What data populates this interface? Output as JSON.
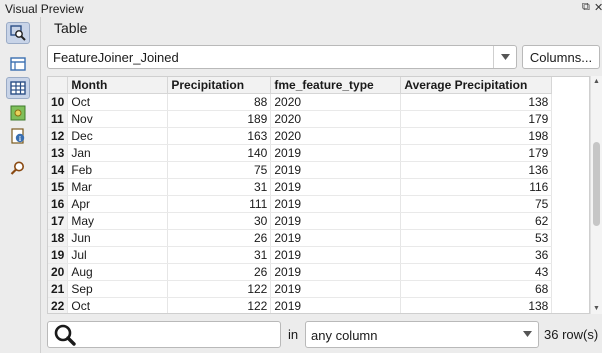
{
  "window": {
    "title": "Visual Preview"
  },
  "panel": {
    "label": "Table"
  },
  "dataset": {
    "selected": "FeatureJoiner_Joined",
    "columns_button": "Columns..."
  },
  "table": {
    "headers": [
      "Month",
      "Precipitation",
      "fme_feature_type",
      "Average Precipitation"
    ],
    "rows": [
      {
        "n": "10",
        "month": "Oct",
        "precip": "88",
        "type": "2020",
        "avg": "138"
      },
      {
        "n": "11",
        "month": "Nov",
        "precip": "189",
        "type": "2020",
        "avg": "179"
      },
      {
        "n": "12",
        "month": "Dec",
        "precip": "163",
        "type": "2020",
        "avg": "198"
      },
      {
        "n": "13",
        "month": "Jan",
        "precip": "140",
        "type": "2019",
        "avg": "179"
      },
      {
        "n": "14",
        "month": "Feb",
        "precip": "75",
        "type": "2019",
        "avg": "136"
      },
      {
        "n": "15",
        "month": "Mar",
        "precip": "31",
        "type": "2019",
        "avg": "116"
      },
      {
        "n": "16",
        "month": "Apr",
        "precip": "111",
        "type": "2019",
        "avg": "75"
      },
      {
        "n": "17",
        "month": "May",
        "precip": "30",
        "type": "2019",
        "avg": "62"
      },
      {
        "n": "18",
        "month": "Jun",
        "precip": "26",
        "type": "2019",
        "avg": "53"
      },
      {
        "n": "19",
        "month": "Jul",
        "precip": "31",
        "type": "2019",
        "avg": "36"
      },
      {
        "n": "20",
        "month": "Aug",
        "precip": "26",
        "type": "2019",
        "avg": "43"
      },
      {
        "n": "21",
        "month": "Sep",
        "precip": "122",
        "type": "2019",
        "avg": "68"
      },
      {
        "n": "22",
        "month": "Oct",
        "precip": "122",
        "type": "2019",
        "avg": "138"
      }
    ]
  },
  "filter": {
    "in_label": "in",
    "column_selected": "any column",
    "row_count": "36 row(s)"
  },
  "icons": {
    "sidebar": [
      "inspect-feature-icon",
      "table-view-icon",
      "grid-view-icon",
      "map-view-icon",
      "info-icon",
      "feature-search-icon"
    ],
    "search": "search-icon",
    "window": [
      "restore-icon",
      "close-icon"
    ]
  },
  "colors": {
    "accent": "#3a6fb0",
    "table_header_bg": "#f2f2f2",
    "selected_sidebar_bg": "#c8d4e8"
  }
}
